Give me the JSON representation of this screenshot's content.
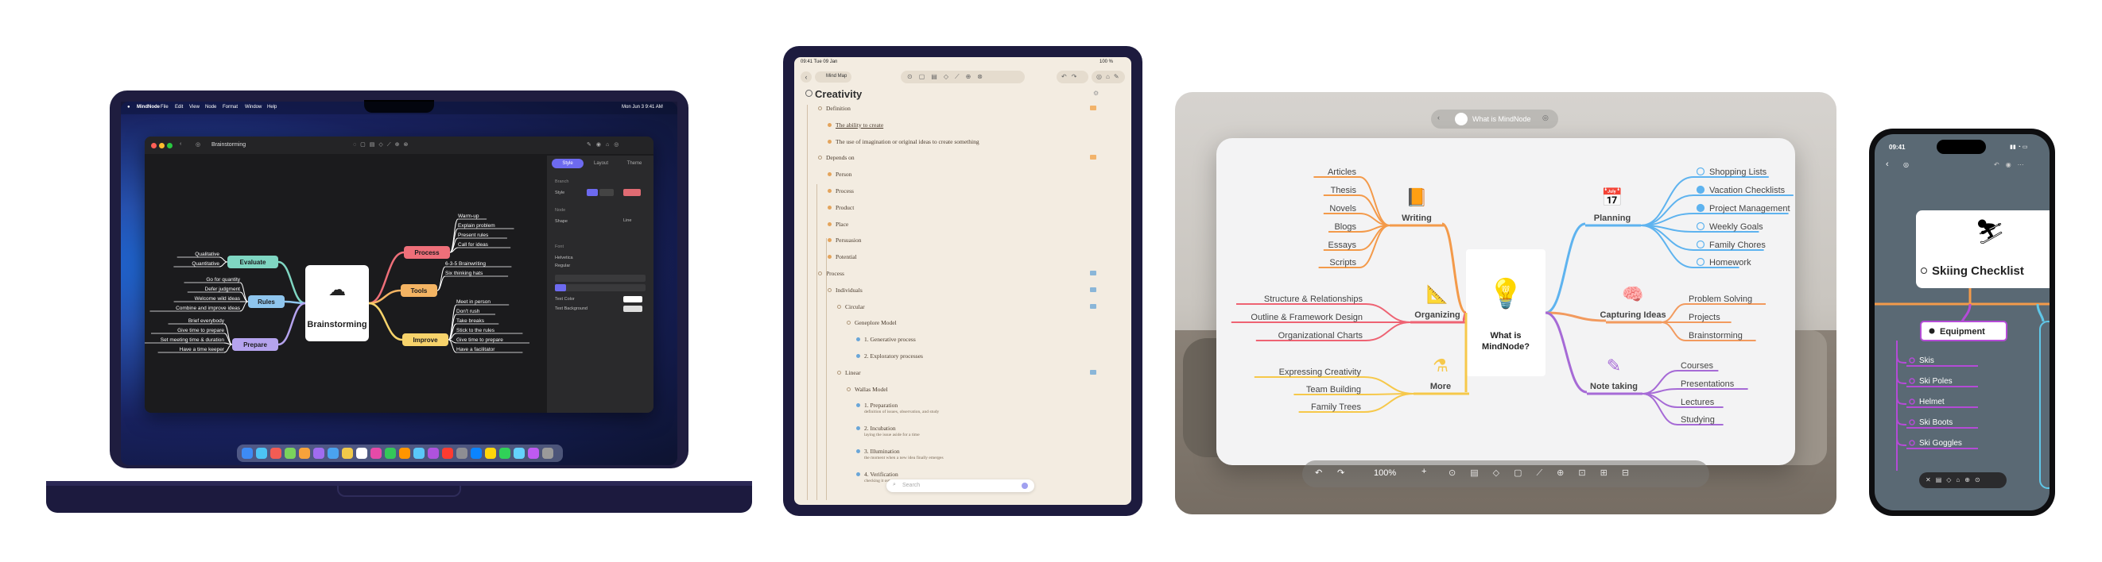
{
  "mac": {
    "menubar": {
      "apple": "",
      "app": "MindNode",
      "items": [
        "File",
        "Edit",
        "View",
        "Node",
        "Format",
        "Window",
        "Help"
      ],
      "clock": "Mon Jun 3  9:41 AM"
    },
    "window_title": "Brainstorming",
    "sidebar_tabs": [
      "Style",
      "Layout",
      "Theme"
    ],
    "sidebar": {
      "branch_label": "Branch",
      "style_label": "Style",
      "node_label": "Node",
      "shape_label": "Shape",
      "shape_value": "Line",
      "font_label": "Font",
      "font_name": "Helvetica",
      "font_weight": "Regular",
      "text_color_label": "Text Color",
      "text_bg_label": "Text Background"
    },
    "map": {
      "center": "Brainstorming",
      "branches": [
        {
          "label": "Evaluate",
          "color": "#7fd6c2",
          "leaves": [
            "Qualitative",
            "Quantitative"
          ]
        },
        {
          "label": "Rules",
          "color": "#8fc6ee",
          "leaves": [
            "Go for quantity",
            "Defer judgment",
            "Welcome wild ideas",
            "Combine and improve ideas"
          ]
        },
        {
          "label": "Prepare",
          "color": "#b5a3ee",
          "leaves": [
            "Brief everybody",
            "Give time to prepare",
            "Set meeting time & duration",
            "Have a time keeper"
          ]
        },
        {
          "label": "Process",
          "color": "#ee6f79",
          "leaves": [
            "Warm-up",
            "Explain problem",
            "Present rules",
            "Call for ideas"
          ]
        },
        {
          "label": "Tools",
          "color": "#f4b463",
          "leaves": [
            "6-3-5 Brainwriting",
            "Six thinking hats"
          ]
        },
        {
          "label": "Improve",
          "color": "#f7d36b",
          "leaves": [
            "Meet in person",
            "Don't rush",
            "Take breaks",
            "Stick to the rules",
            "Give time to prepare",
            "Have a facilitator"
          ]
        }
      ]
    }
  },
  "ipad": {
    "status_time": "09:41  Tue 09 Jan",
    "status_battery": "100 %",
    "doc_title": "Mind Map",
    "outline_title": "Creativity",
    "outline": [
      {
        "text": "Definition",
        "level": 1
      },
      {
        "text": "The ability to create",
        "level": 2
      },
      {
        "text": "The use of imagination or original ideas to create something",
        "level": 2
      },
      {
        "text": "Depends on",
        "level": 1
      },
      {
        "text": "Person",
        "level": 2
      },
      {
        "text": "Process",
        "level": 2
      },
      {
        "text": "Product",
        "level": 2
      },
      {
        "text": "Place",
        "level": 2
      },
      {
        "text": "Persuasion",
        "level": 2
      },
      {
        "text": "Potential",
        "level": 2
      },
      {
        "text": "Process",
        "level": 1
      },
      {
        "text": "Individuals",
        "level": 2
      },
      {
        "text": "Circular",
        "level": 3
      },
      {
        "text": "Geneplore Model",
        "level": 4
      },
      {
        "text": "1. Generative process",
        "level": 5
      },
      {
        "text": "2. Exploratory processes",
        "level": 5
      },
      {
        "text": "Linear",
        "level": 3
      },
      {
        "text": "Wallas Model",
        "level": 4
      },
      {
        "text": "1. Preparation",
        "level": 5,
        "note": "definition of issues, observation, and study"
      },
      {
        "text": "2. Incubation",
        "level": 5,
        "note": "laying the issue aside for a time"
      },
      {
        "text": "3. Illumination",
        "level": 5,
        "note": "the moment when a new idea finally emerges"
      },
      {
        "text": "4. Verification",
        "level": 5,
        "note": "checking it out"
      }
    ],
    "search_placeholder": "Search"
  },
  "vision": {
    "title": "What is MindNode",
    "center": "What is MindNode?",
    "zoom": "100%",
    "branches": [
      {
        "label": "Writing",
        "color": "#f39a4a",
        "leaves": [
          "Articles",
          "Thesis",
          "Novels",
          "Blogs",
          "Essays",
          "Scripts"
        ]
      },
      {
        "label": "Organizing",
        "color": "#ee6373",
        "leaves": [
          "Structure & Relationships",
          "Outline & Framework Design",
          "Organizational Charts"
        ]
      },
      {
        "label": "More",
        "color": "#f6c84a",
        "leaves": [
          "Expressing Creativity",
          "Team Building",
          "Family Trees"
        ]
      },
      {
        "label": "Planning",
        "color": "#5eb3ef",
        "leaves": [
          "Shopping Lists",
          "Vacation Checklists",
          "Project Management",
          "Weekly Goals",
          "Family Chores",
          "Homework"
        ],
        "checked": [
          false,
          true,
          true,
          false,
          false,
          false
        ]
      },
      {
        "label": "Capturing Ideas",
        "color": "#f29a5e",
        "leaves": [
          "Problem Solving",
          "Projects",
          "Brainstorming"
        ]
      },
      {
        "label": "Note taking",
        "color": "#a66ad6",
        "leaves": [
          "Courses",
          "Presentations",
          "Lectures",
          "Studying"
        ]
      }
    ]
  },
  "phone": {
    "time": "09:41",
    "title": "Skiing Checklist",
    "branch": "Equipment",
    "items": [
      "Skis",
      "Ski Poles",
      "Helmet",
      "Ski Boots",
      "Ski Goggles"
    ]
  }
}
